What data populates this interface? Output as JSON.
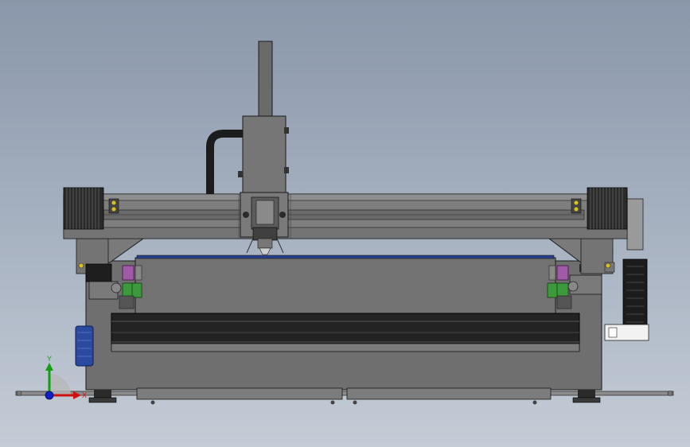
{
  "viewport": {
    "type": "cad-3d-viewport",
    "view": "front",
    "model": "cnc-gantry-machine"
  },
  "triad": {
    "x_label": "X",
    "y_label": "Y",
    "x_color": "#d01010",
    "y_color": "#10a010",
    "z_color": "#1020c0"
  },
  "colors": {
    "background_top": "#8a97aa",
    "background_bottom": "#c4ccd6",
    "frame_gray": "#6e6e6e",
    "outline": "#1a1a1a",
    "motor_green": "#3c9a3c",
    "motor_purple": "#a05aa8",
    "motor_blue": "#2a4aa0",
    "bellows_dark": "#2b2b2b",
    "indicator_yellow": "#d8c020"
  }
}
